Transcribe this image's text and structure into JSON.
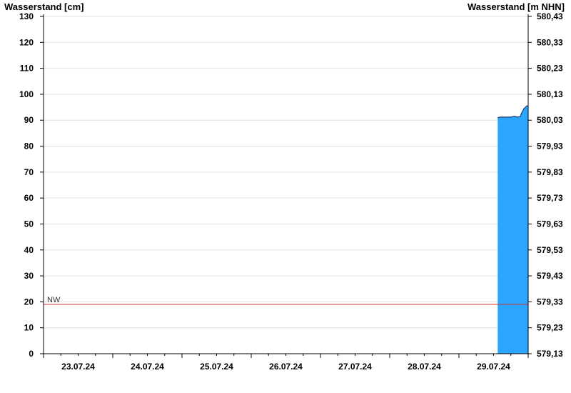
{
  "chart_data": {
    "type": "area",
    "ylabel_left": "Wasserstand [cm]",
    "ylabel_right": "Wasserstand [m NHN]",
    "ylim_left": [
      0,
      130
    ],
    "ylim_right": [
      579.13,
      580.43
    ],
    "yticks_left": [
      "0",
      "10",
      "20",
      "30",
      "40",
      "50",
      "60",
      "70",
      "80",
      "90",
      "100",
      "110",
      "120",
      "130"
    ],
    "yticks_right": [
      "579,13",
      "579,23",
      "579,33",
      "579,43",
      "579,53",
      "579,63",
      "579,73",
      "579,83",
      "579,93",
      "580,03",
      "580,13",
      "580,23",
      "580,33",
      "580,43"
    ],
    "x_categories": [
      "23.07.24",
      "24.07.24",
      "25.07.24",
      "26.07.24",
      "27.07.24",
      "28.07.24",
      "29.07.24"
    ],
    "x_range_days": [
      0,
      7
    ],
    "grid": true,
    "reference_line": {
      "label": "NW",
      "value": 19,
      "color": "#cc3333"
    },
    "series": [
      {
        "color": "#2ba6ff",
        "x_days": [
          6.56,
          6.6,
          6.7,
          6.75,
          6.8,
          6.8,
          6.85,
          6.89,
          6.9,
          6.92,
          6.94,
          6.96,
          6.98,
          7.0
        ],
        "values": [
          91,
          91.2,
          91.2,
          91.2,
          91.5,
          91.5,
          91.2,
          91.5,
          92.5,
          93.5,
          94.5,
          95,
          95.5,
          95.5
        ]
      }
    ]
  }
}
